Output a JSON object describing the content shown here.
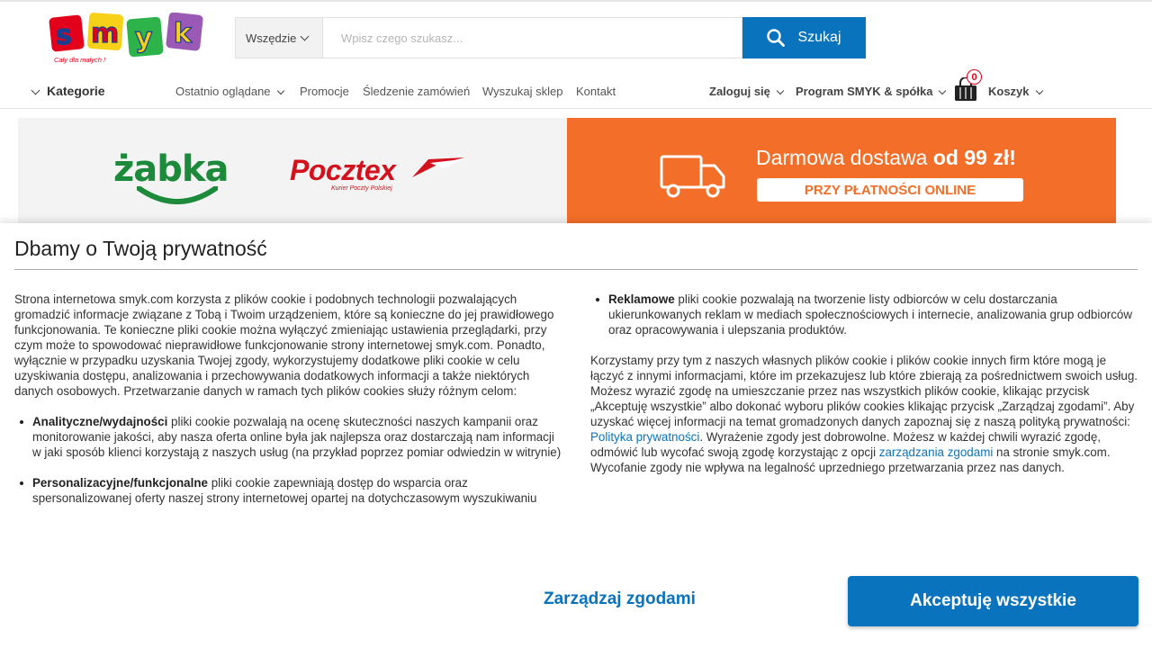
{
  "colors": {
    "brand_blue": "#0a73bd",
    "promo_orange": "#f36f29",
    "zabka_green": "#1c8a3a",
    "pocztex_red": "#d4121d"
  },
  "header": {
    "logo_text": "smyk",
    "logo_tagline": "Cały dla małych !",
    "search": {
      "category": "Wszędzie",
      "placeholder": "Wpisz czego szukasz...",
      "button_label": "Szukaj",
      "button_icon": "search-icon"
    }
  },
  "nav": {
    "categories_label": "Kategorie",
    "links": {
      "recently_viewed": "Ostatnio oglądane",
      "promotions": "Promocje",
      "track_order": "Śledzenie zamówień",
      "find_store": "Wyszukaj sklep",
      "contact": "Kontakt"
    },
    "login_label": "Zaloguj się",
    "program_label": "Program SMYK & spółka",
    "cart_label": "Koszyk",
    "cart_count": "0"
  },
  "banner": {
    "partner_1": "żabka",
    "partner_2": "Pocztex",
    "partner_2_sub": "Kurier Poczty Polskiej",
    "promo_text_1": "Darmowa dostawa",
    "promo_text_2": "od 99 zł!",
    "promo_badge": "PRZY PŁATNOŚCI ONLINE"
  },
  "cookie": {
    "title": "Dbamy o Twoją prywatność",
    "intro": "Strona internetowa smyk.com korzysta z plików cookie i podobnych technologii pozwalających gromadzić informacje związane z Tobą i Twoim urządzeniem, które są konieczne do jej prawidłowego funkcjonowania. Te konieczne pliki cookie można wyłączyć zmieniając ustawienia przeglądarki, przy czym może to spowodować nieprawidłowe funkcjonowanie strony internetowej smyk.com. Ponadto, wyłącznie w przypadku uzyskania Twojej zgody, wykorzystujemy dodatkowe pliki cookie w celu uzyskiwania dostępu, analizowania i przechowywania dodatkowych informacji a także niektórych danych osobowych. Przetwarzanie danych w ramach tych plików cookies służy różnym celom:",
    "bullet_1_title": "Analityczne/wydajności",
    "bullet_1_text": " pliki cookie pozwalają na ocenę skuteczności naszych kampanii oraz monitorowanie jakości, aby nasza oferta online była jak najlepsza oraz dostarczają nam informacji w jaki sposób klienci korzystają z naszych usług (na przykład poprzez pomiar odwiedzin w witrynie)",
    "bullet_2_title": "Personalizacyjne/funkcjonalne",
    "bullet_2_text": " pliki cookie zapewniają dostęp do wsparcia oraz spersonalizowanej oferty naszej strony internetowej opartej na dotychczasowym wyszukiwaniu",
    "bullet_3_title": "Reklamowe",
    "bullet_3_text": " pliki cookie pozwalają na tworzenie listy odbiorców w celu dostarczania ukierunkowanych reklam w mediach społecznościowych i internecie, analizowania grup odbiorców oraz opracowywania i ulepszania produktów.",
    "right_text_1": "Korzystamy przy tym z naszych własnych plików cookie i plików cookie innych firm które mogą je łączyć z innymi informacjami, które im przekazujesz lub które zbierają za pośrednictwem swoich usług. Możesz wyrazić zgodę na umieszczanie przez nas wszystkich plików cookie, klikając przycisk „Akceptuję wszystkie” albo dokonać wyboru plików cookies klikając przycisk „Zarządzaj zgodami”. Aby uzyskać więcej informacji na temat gromadzonych danych zapoznaj się z naszą polityką prywatności: ",
    "privacy_link": "Polityka prywatności",
    "right_text_2": ". Wyrażenie zgody jest dobrowolne. Możesz w każdej chwili wyrazić zgodę, odmówić lub wycofać swoją zgodę korzystając z opcji ",
    "manage_link": "zarządzania zgodami",
    "right_text_3": " na stronie smyk.com. Wycofanie zgody nie wpływa na legalność uprzedniego przetwarzania przez nas danych.",
    "manage_button": "Zarządzaj zgodami",
    "accept_button": "Akceptuję wszystkie"
  }
}
